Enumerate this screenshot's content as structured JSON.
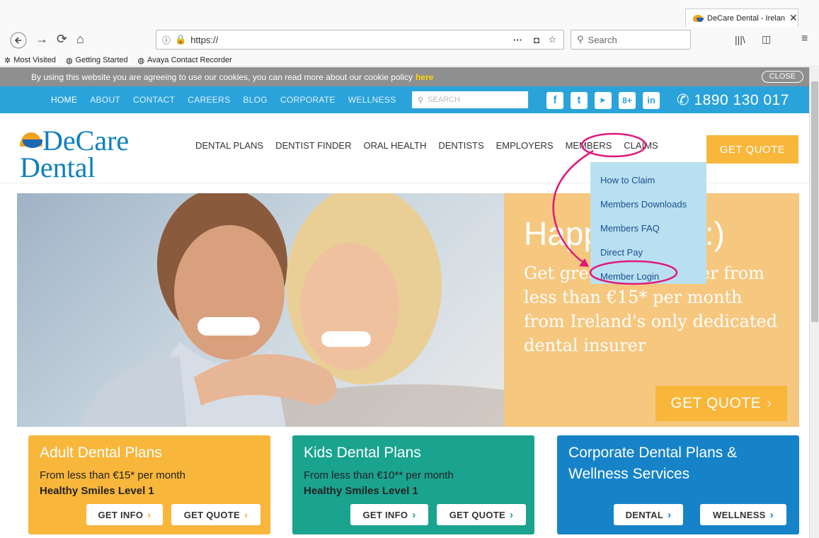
{
  "browser": {
    "tab_title": "DeCare Dental - Ireland",
    "url": "https://",
    "search_placeholder": "Search",
    "bookmarks": [
      "Most Visited",
      "Getting Started",
      "Avaya Contact Recorder"
    ]
  },
  "cookie_bar": {
    "text": "By using this website you are agreeing to use our cookies, you can read more about our cookie policy",
    "link": "here",
    "close": "CLOSE"
  },
  "top_nav": {
    "items": [
      "HOME",
      "ABOUT",
      "CONTACT",
      "CAREERS",
      "BLOG",
      "CORPORATE",
      "WELLNESS"
    ],
    "search_placeholder": "SEARCH",
    "phone": "1890 130 017"
  },
  "logo": {
    "line1": "DeCare",
    "line2": "Dental"
  },
  "main_nav": {
    "items": [
      "DENTAL PLANS",
      "DENTIST FINDER",
      "ORAL HEALTH",
      "DENTISTS",
      "EMPLOYERS",
      "MEMBERS",
      "CLAIMS"
    ],
    "cta": "GET QUOTE"
  },
  "members_dropdown": [
    "How to Claim",
    "Members Downloads",
    "Members FAQ",
    "Direct Pay",
    "Member Login"
  ],
  "hero": {
    "title": "Happy days :)",
    "subtitle": "Get great dental cover from less than €15* per month from Ireland's only dedicated dental insurer",
    "cta": "GET QUOTE"
  },
  "cards": [
    {
      "title": "Adult Dental Plans",
      "line1": "From less than €15* per month",
      "line2": "Healthy Smiles Level 1",
      "btn1": "GET INFO",
      "btn2": "GET QUOTE",
      "color": "#f8b63b"
    },
    {
      "title": "Kids Dental Plans",
      "line1": "From less than €10** per month",
      "line2": "Healthy Smiles Level 1",
      "btn1": "GET INFO",
      "btn2": "GET QUOTE",
      "color": "#1aa38f"
    },
    {
      "title": "Corporate Dental Plans & Wellness Services",
      "btn1": "DENTAL",
      "btn2": "WELLNESS",
      "color": "#1683c8"
    }
  ],
  "colors": {
    "accent_blue": "#2aa3db",
    "orange": "#f8b63b",
    "highlight": "#e0197d"
  }
}
